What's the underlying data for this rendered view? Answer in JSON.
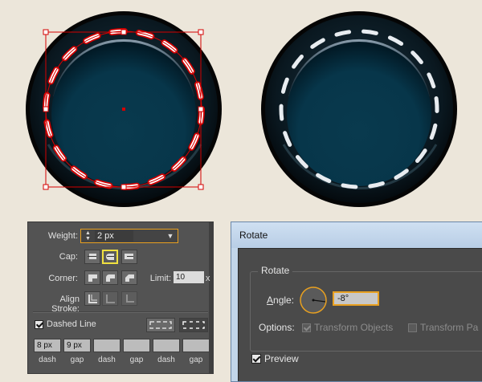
{
  "stroke_panel": {
    "weight_label": "Weight:",
    "weight_value": "2 px",
    "cap_label": "Cap:",
    "corner_label": "Corner:",
    "limit_label": "Limit:",
    "limit_value": "10",
    "limit_unit": "x",
    "align_label": "Align Stroke:",
    "dashed_line_label": "Dashed Line",
    "dashed_line_checked": true,
    "dash_fields": [
      {
        "value": "8 px",
        "label": "dash"
      },
      {
        "value": "9 px",
        "label": "gap"
      },
      {
        "value": "",
        "label": "dash"
      },
      {
        "value": "",
        "label": "gap"
      },
      {
        "value": "",
        "label": "dash"
      },
      {
        "value": "",
        "label": "gap"
      }
    ]
  },
  "rotate_dialog": {
    "title": "Rotate",
    "group_label": "Rotate",
    "angle_label": "Angle:",
    "angle_value": "-8°",
    "options_label": "Options:",
    "transform_objects": "Transform Objects",
    "transform_patterns": "Transform Pa",
    "preview_label": "Preview"
  },
  "colors": {
    "canvas": "#ece6da",
    "selection": "#d40000",
    "dash_white": "#e8ecf0",
    "focus_orange": "#e8a020",
    "selected_button": "#f0e040"
  }
}
